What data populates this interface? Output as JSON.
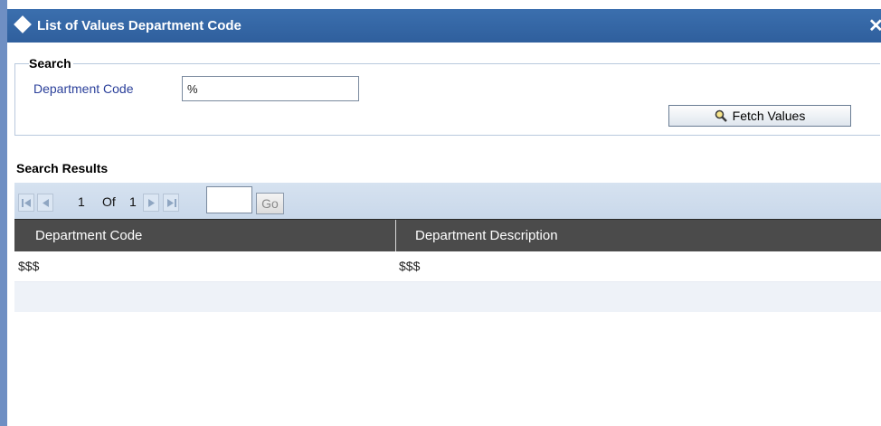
{
  "dialog": {
    "title": "List of Values Department Code",
    "close_glyph": "✕"
  },
  "search": {
    "legend": "Search",
    "field_label": "Department Code",
    "field_value": "%",
    "fetch_label": "Fetch Values"
  },
  "results": {
    "title": "Search Results",
    "pager": {
      "current": "1",
      "of_label": "Of",
      "total": "1",
      "goto_value": "",
      "go_label": "Go"
    },
    "columns": [
      "Department Code",
      "Department Description"
    ],
    "rows": [
      [
        "$$$",
        "$$$"
      ]
    ]
  },
  "colors": {
    "titlebar": "#2f5f9d",
    "label_blue": "#2a3f9a",
    "header_dark": "#4b4b4b",
    "pager_bg": "#c9d8ea"
  }
}
